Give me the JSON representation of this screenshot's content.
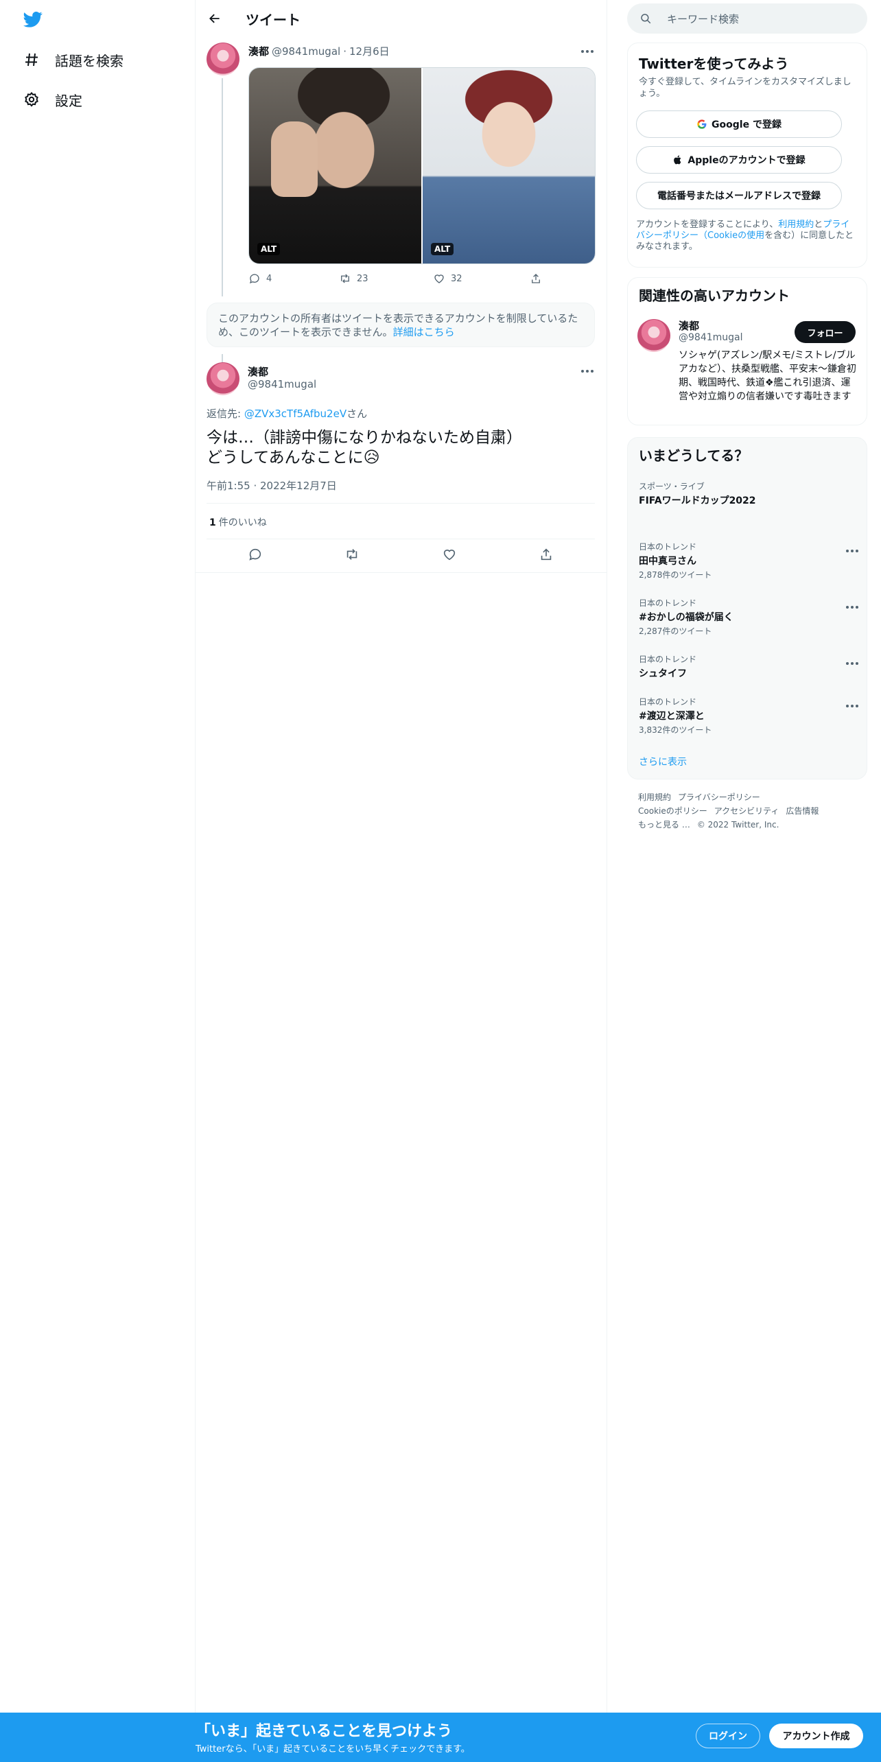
{
  "nav": {
    "explore_label": "話題を検索",
    "settings_label": "設定"
  },
  "header": {
    "title": "ツイート"
  },
  "tweet1": {
    "name": "湊都",
    "handle": "@9841mugal",
    "sep": "·",
    "date": "12月6日",
    "alt_left": "ALT",
    "alt_right": "ALT",
    "replies": "4",
    "retweets": "23",
    "likes": "32"
  },
  "notice": {
    "text": "このアカウントの所有者はツイートを表示できるアカウントを制限しているため、このツイートを表示できません。",
    "link": "詳細はこちら"
  },
  "tweet2": {
    "name": "湊都",
    "handle": "@9841mugal",
    "reply_prefix": "返信先: ",
    "reply_to": "@ZVx3cTf5Afbu2eV",
    "reply_suffix": "さん",
    "text": "今は…（誹謗中傷になりかねないため自粛）\nどうしてあんなことに😥",
    "time": "午前1:55 · 2022年12月7日",
    "like_count": "1",
    "like_label": "件のいいね"
  },
  "sidebar": {
    "search_placeholder": "キーワード検索",
    "signup": {
      "title": "Twitterを使ってみよう",
      "sub": "今すぐ登録して、タイムラインをカスタマイズしましょう。",
      "google": "Google で登録",
      "apple": "Appleのアカウントで登録",
      "phone": "電話番号またはメールアドレスで登録",
      "legal_pre": "アカウントを登録することにより、",
      "legal_terms": "利用規約",
      "legal_and": "と",
      "legal_privacy": "プライバシーポリシー（Cookieの使用",
      "legal_post": "を含む）に同意したとみなされます。"
    },
    "who_to_follow": {
      "title": "関連性の高いアカウント",
      "name": "湊都",
      "handle": "@9841mugal",
      "follow": "フォロー",
      "bio": "ソシャゲ(アズレン/駅メモ/ミストレ/ブルアカなど）、扶桑型戦艦、平安末～鎌倉初期、戦国時代、鉄道❖艦これ引退済、運営や対立煽りの信者嫌いです毒吐きます"
    },
    "trends": {
      "title": "いまどうしてる？",
      "items": [
        {
          "context": "スポーツ・ライブ",
          "name": "FIFAワールドカップ2022",
          "count": ""
        },
        {
          "context": "日本のトレンド",
          "name": "田中真弓さん",
          "count": "2,878件のツイート"
        },
        {
          "context": "日本のトレンド",
          "name": "#おかしの福袋が届く",
          "count": "2,287件のツイート"
        },
        {
          "context": "日本のトレンド",
          "name": "シュタイフ",
          "count": ""
        },
        {
          "context": "日本のトレンド",
          "name": "#渡辺と深澤と",
          "count": "3,832件のツイート"
        }
      ],
      "show_more": "さらに表示"
    },
    "footer": {
      "terms": "利用規約",
      "privacy": "プライバシーポリシー",
      "cookie": "Cookieのポリシー",
      "accessibility": "アクセシビリティ",
      "ads": "広告情報",
      "more": "もっと見る …",
      "copyright": "© 2022 Twitter, Inc."
    }
  },
  "banner": {
    "title": "「いま」起きていることを見つけよう",
    "sub": "Twitterなら、「いま」起きていることをいち早くチェックできます。",
    "login": "ログイン",
    "signup": "アカウント作成"
  },
  "colors": {
    "accent": "#1d9bf0",
    "text": "#0f1419",
    "muted": "#536471"
  }
}
